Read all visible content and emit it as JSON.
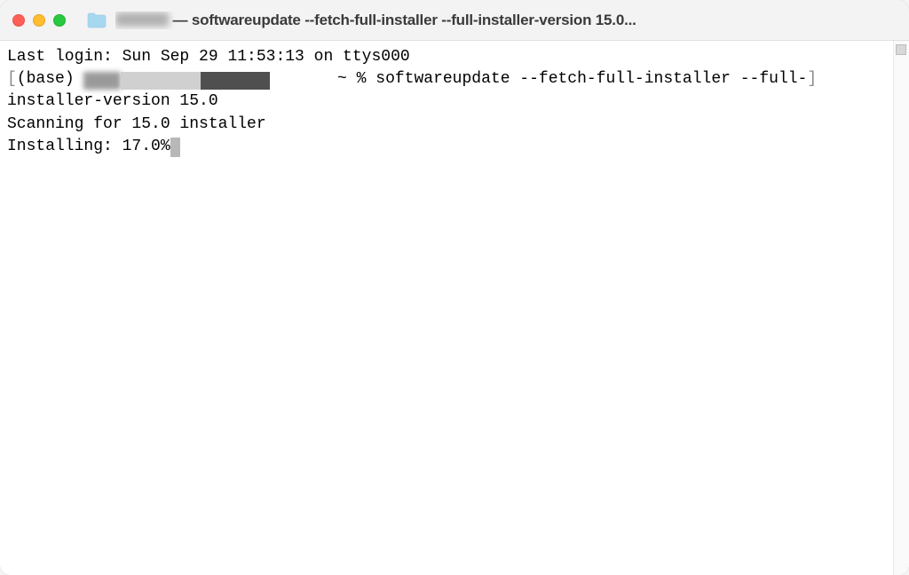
{
  "titlebar": {
    "title_prefix": "",
    "title_after_user": " — softwareupdate --fetch-full-installer --full-installer-version 15.0..."
  },
  "terminal": {
    "last_login": "Last login: Sun Sep 29 11:53:13 on ttys000",
    "prompt_open_bracket": "[",
    "prompt_env": "(base) ",
    "prompt_path_symbol": " ~ % ",
    "command_part1": "softwareupdate --fetch-full-installer --full-",
    "prompt_close_bracket": "]",
    "command_part2": "installer-version 15.0",
    "scanning_line": "Scanning for 15.0 installer",
    "installing_line": "Installing: 17.0%"
  }
}
